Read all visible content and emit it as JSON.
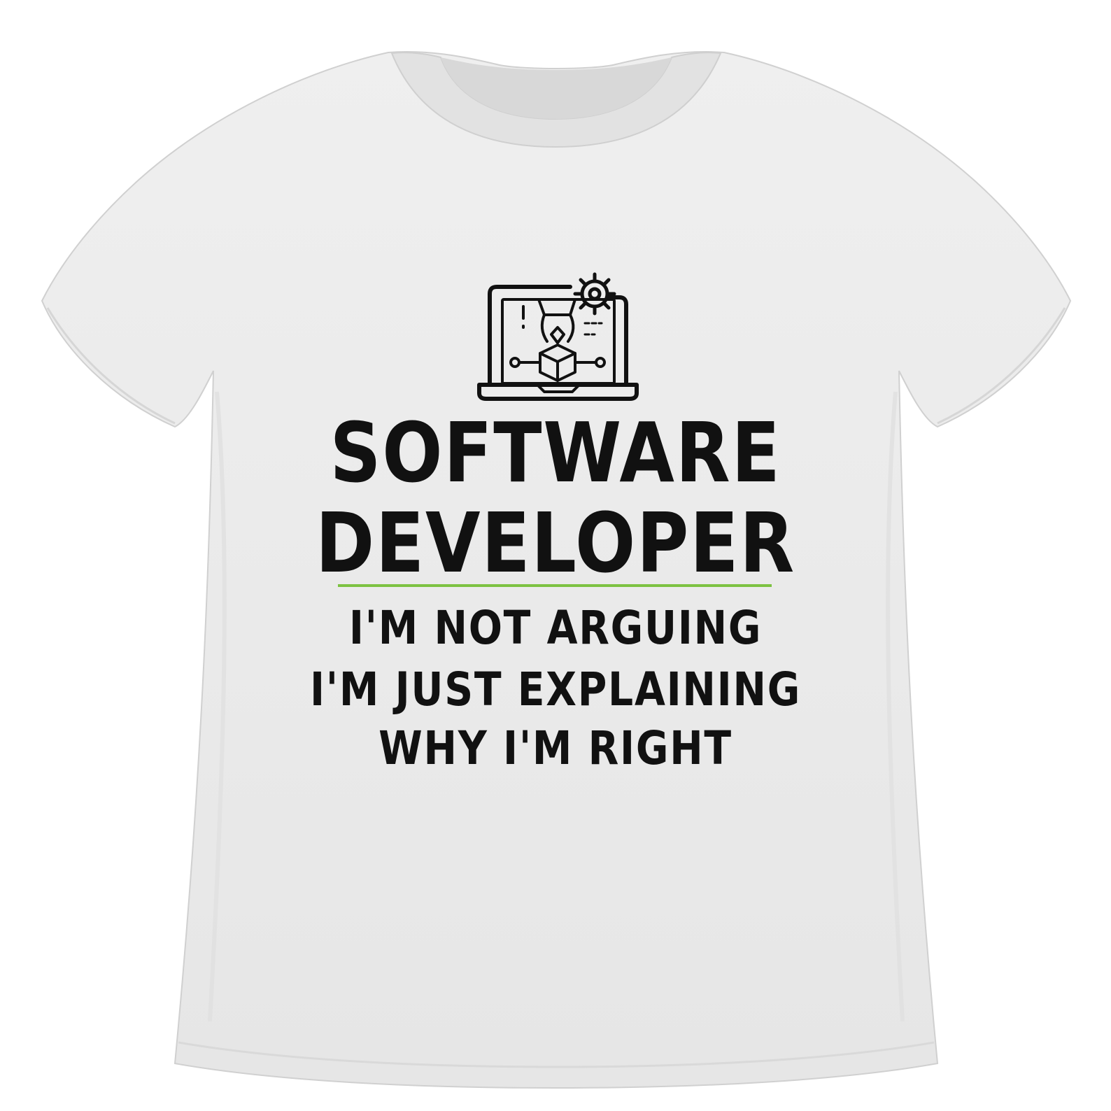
{
  "print": {
    "headline_line_1": "SOFTWARE",
    "headline_line_2": "DEVELOPER",
    "tagline_line_1": "I'M NOT ARGUING",
    "tagline_line_2": "I'M JUST EXPLAINING",
    "tagline_line_3": "WHY I'M RIGHT"
  },
  "graphic": {
    "icon": "laptop-gear-developer-icon",
    "description_icons": [
      "laptop-icon",
      "gear-icon",
      "robot-arm-icon",
      "box-icon",
      "node-icon"
    ]
  },
  "colors": {
    "shirt": "#ebebeb",
    "shirt_shadow": "#d4d4d4",
    "ink": "#111111",
    "accent_line": "#7dc242",
    "background": "#ffffff"
  }
}
